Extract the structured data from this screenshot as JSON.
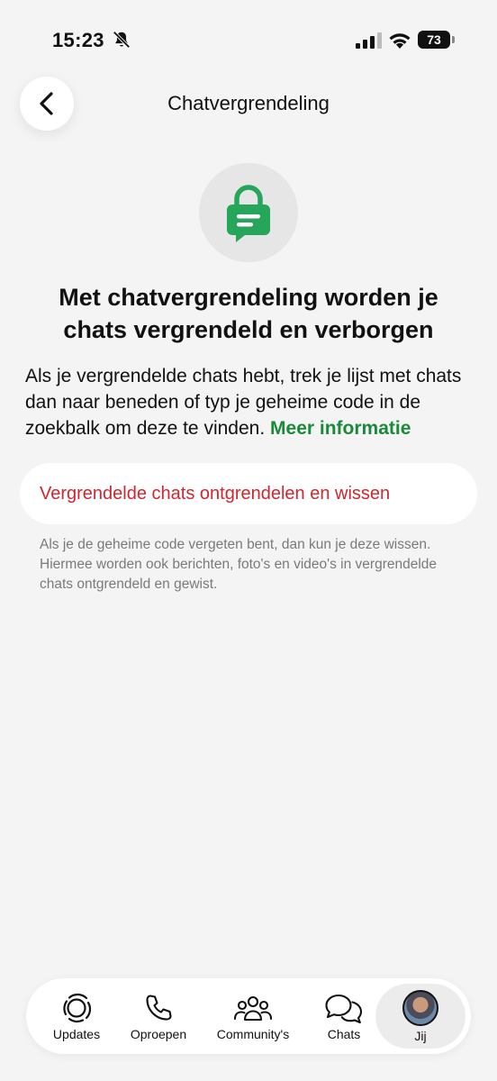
{
  "status": {
    "time": "15:23",
    "battery": "73"
  },
  "header": {
    "title": "Chatvergrendeling"
  },
  "content": {
    "headline": "Met chatvergrendeling worden je chats vergrendeld en verborgen",
    "description": "Als je vergrendelde chats hebt, trek je lijst met chats dan naar beneden of typ je geheime code in de zoekbalk om deze te vinden.",
    "more_info": "Meer informatie",
    "unlock_action": "Vergrendelde chats ontgrendelen en wissen",
    "footnote": "Als je de geheime code vergeten bent, dan kun je deze wissen. Hiermee worden ook berichten, foto's en video's in vergrendelde chats ontgrendeld en gewist."
  },
  "tabs": {
    "updates": "Updates",
    "calls": "Oproepen",
    "communities": "Community's",
    "chats": "Chats",
    "you": "Jij"
  },
  "colors": {
    "accent_green": "#1a8a3a",
    "lock_green": "#25a65a",
    "destructive_red": "#d0262f",
    "background": "#f4f4f4"
  },
  "icons": {
    "status": [
      "bell-off-icon",
      "signal-icon",
      "wifi-icon",
      "battery-icon"
    ],
    "header": "chevron-left-icon",
    "hero": "locked-chat-icon",
    "tabs": [
      "updates-icon",
      "phone-icon",
      "communities-icon",
      "chats-icon",
      "avatar"
    ]
  }
}
